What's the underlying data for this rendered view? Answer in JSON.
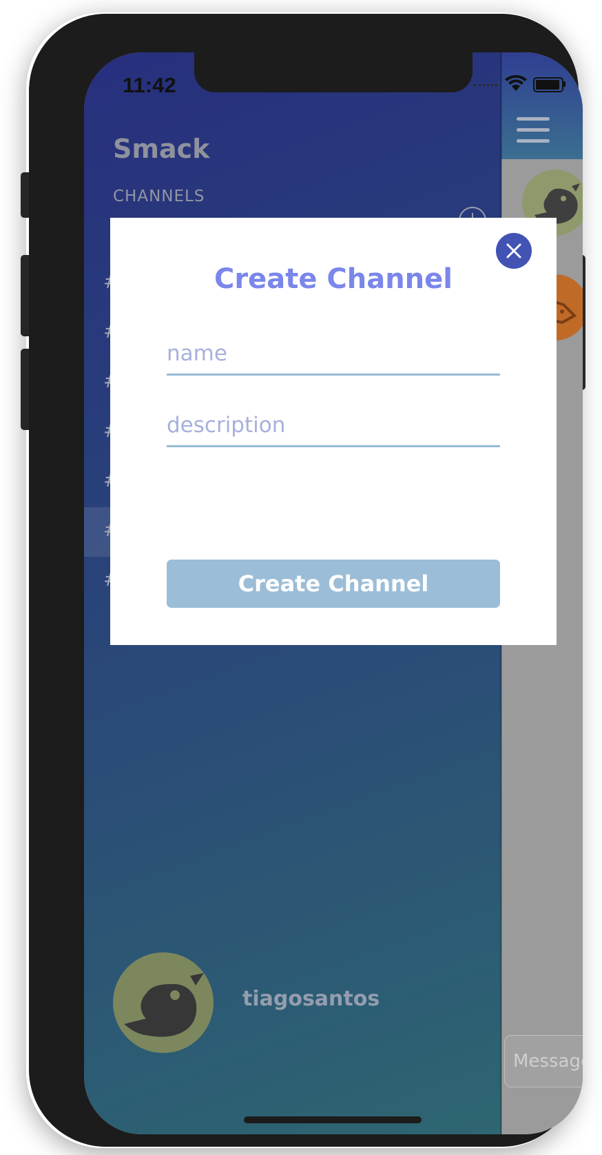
{
  "status_bar": {
    "time": "11:42"
  },
  "sidebar": {
    "app_title": "Smack",
    "section_label": "CHANNELS",
    "channels": [
      {
        "prefix": "#"
      },
      {
        "prefix": "#"
      },
      {
        "prefix": "#"
      },
      {
        "prefix": "#"
      },
      {
        "prefix": "#"
      },
      {
        "prefix": "#",
        "selected": true
      },
      {
        "prefix": "#"
      }
    ],
    "user": {
      "username": "tiagosantos"
    }
  },
  "chat": {
    "message_placeholder": "Message"
  },
  "modal": {
    "title": "Create Channel",
    "name_placeholder": "name",
    "description_placeholder": "description",
    "create_button_label": "Create Channel"
  },
  "colors": {
    "modal_accent": "#7a86ea",
    "close_button": "#4353b4",
    "button_bg": "#9bbdd7",
    "field_underline": "#97bad4"
  }
}
